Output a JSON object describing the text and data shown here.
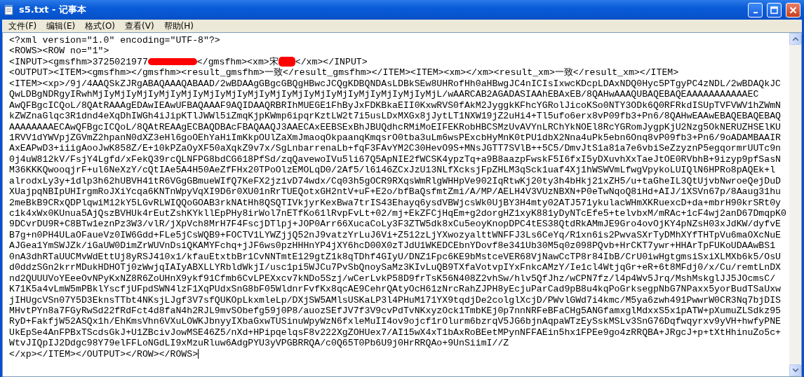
{
  "window": {
    "title": "s5.txt - 记事本"
  },
  "menu": [
    {
      "label": "文件(F)"
    },
    {
      "label": "编辑(E)"
    },
    {
      "label": "格式(O)"
    },
    {
      "label": "查看(V)"
    },
    {
      "label": "帮助(H)"
    }
  ],
  "editor": {
    "lines": [
      {
        "text": "<?xml version=\"1.0\" encoding=\"UTF-8\"?>"
      },
      {
        "text": "<ROWS><ROW no=\"1\">"
      },
      {
        "parts": [
          {
            "kind": "text",
            "text": "<INPUT><gmsfhm>3725021977"
          },
          {
            "kind": "redaction"
          },
          {
            "kind": "text",
            "text": "</gmsfhm><xm>宋"
          },
          {
            "kind": "redaction"
          },
          {
            "kind": "text",
            "text": "</xm></INPUT>"
          }
        ]
      },
      {
        "text": "<OUTPUT><ITEM><gmsfhm></gmsfhm><result_gmsfhm>一致</result_gmsfhm></ITEM><ITEM><xm></xm><result_xm>一致</result_xm></ITEM>"
      },
      {
        "text": "<ITEM><xp>/9j/4AAQSkZJRgABAQAAAQABAAD/2wBDAAgGBgcGBQgHBwcJCQgKDBQNDAsLDBkSEw8UHRofHh0aHBwgJC4nICIsIxwcKDcpLDAxNDQ0Hyc5PTgyPC4zNDL/2wBDAQkJC"
      },
      {
        "text": "QwLDBgNDRgyIRwhMjIyMjIyMjIyMjIyMjIyMjIyMjIyMjIyMjIyMjIyMjIyMjIyMjIyMjIyMjIyMjL/wAARCAB2AGADASIAAhEBAxEB/8QAHwAAAQUBAQEBAQEAAAAAAAAAAAEC"
      },
      {
        "text": "AwQFBgcICQoL/8QAtRAAAgEDAwIEAwUFBAQAAAF9AQIDAAQRBRIhMUEGE1FhByJxFDKBkaEII0KxwRVS0fAkM2JyggkKFhcYGRolJicoKSo0NTY3ODk6Q0RFRkdISUpTVFVWV1hZWmN"
      },
      {
        "text": "kZWZnaGlqc3R1dnd4eXqDhIWGh4iJipKTlJWWl5iZmqKjpKWmp6ipqrKztLW2t7i5usLDxMXGx8jJytLT1NXW19jZ2uHi4+Tl5ufo6erx8vP09fb3+Pn6/8QAHwEAAwEBAQEBAQEBAQ"
      },
      {
        "text": "AAAAAAAAECAwQFBgcICQoL/8QAtREAAgECBAQDBAcFBAQAAQJ3AAECAxEEBSExBhJBUQdhcRMiMoEIFEKRobHBCSMzUvAVYnLRChYkNOEl8RcYGRomJygpKjU2Nzg5OkNERUZHSElKU"
      },
      {
        "text": "1RVV1dYWVpjZGVmZ2hpanN0dXZ3eHl6goOEhYaHiImKkpOUlZaXmJmaoqOkpaanqKmqsrO0tba3uLm6wsPExcbHyMnK0tPU1dbX2Nna4uPk5ebn6Onq8vP09fb3+Pn6/9oADAMBAAIR"
      },
      {
        "text": "AxEAPwD3+iiigAooJwK858Z/E+10kPZaOyXF50aXqkZ9v7x/SgLnbarrenaLb+fqF3FAvYM2C30HevO9S+MNsJGTT7SVlB++5C5/DmvJtS1a81a7e6vbiSeZzyznP5egqormrUUTc9n"
      },
      {
        "text": "0j4uW812kV/FsjY4Lgfd/xFekQ39rcQLNFPG8bdCG618PfSd/zqQavewoIVu5li67Q5ApNIE2fWCSK4ypzTq+a9B8aazpFwskF5I6fxI5yDXuvhXxTaeJtOE0RVbhB+9izyp9pfSasN"
      },
      {
        "text": "M36KKKQwooqjrF+ul6NeXzY/cQtIAe5A4H50AeZfFHx20TPoOlzEMOLqD0/2Af5/l6146ZCxJzU13NLfXcksjFpZHLM3qSck1uaf4Xj1hWSWVmLfwgVpykoLUIQlN6HPRo8pAQEk+l"
      },
      {
        "text": "alrodxLy3y+1dlp3h62hUBVH41tR6VGgGBmueWIfQ7KeFX2jz1vD74wdx/Cq03h5gOCR9RXqsWmRlgWHHpVe902IqRtwKj20ty3h4bHkj21xZH5/u+taGheIL3QtUjvbNwroeQejDuD"
      },
      {
        "text": "XUajpqNBIpUHIrgmRoJXiYcqa6KNTnWpyVqXI9D6r0XU01nRrTUEQotxGH2ntV+uF+E2o/bfBaQsfmtZmi/A/MP/AELH4V3VUzNBXN+P0eTwNqoQ8iHd+AIJ/1XSVn67p/8Aaug31hu"
      },
      {
        "text": "2meBkB9CRxQDPlqwiM12kY5LGvRLWIQQoGOAB3rkNAtHh8QSQTIVkjyrKexBwa7trIS43Ehayq6ysdVBWjcsWk0UjBY3H4mty02ATJ571ykulacWHmXKRuexcD+da+mbrH90krSRt0y"
      },
      {
        "text": "c1k4xWx0KUnua5AjQszBVHUk4rEutZshKYkllEpPHy8irWol7nETfKo61lRvpFvLt+02/mj+EkZFCjHqEm+g2dorgHZ1xyK881yDyNTcEfe5+telvbxM/mRAc+1cF4wj2anD67DmqpK0"
      },
      {
        "text": "9DCvrDU9R+C8BTw1eznPz3W3/vlR/jXpVch8MrH7F4FscjDTlpj+JOP0Arr66XucaCoLy3F3ZTW5dk8xCu5eoyKnopDPC4tES38QtdRkAMmJE9Gro4ovOjKY4pNZsH03xJdKW/dyfvE"
      },
      {
        "text": "B7g+n0PH4ULaOFaueVz0IW6Gdd+FLe5jCsWQB9+FOCTV1LYWZjjQ52nJ9vatzYrLuJ6Vi+Z512zLjYXwozyalttWNFFJ3Ls6CeYq/R1xn6is2PwvaSXrTyDMhXYfTHTpVu6maOXcNuE"
      },
      {
        "text": "AJGea1YmSWJZk/iGaUW0DimZrWUVnDsiQKAMYFchq+jJF6ws0pzHHHnYP4jXY6hcD00X0zTJdU1WKEDCEbnYDovf8e341Ub30M5q0z098PQvb+HrCKT7ywr+HHArTpFUKoUDAAwBS1"
      },
      {
        "text": "0nA3dhRTaUUCMvWdEttUj8yRSJ410x1/kfauEtxtbBr1CvNNTmtE129gtZ1k8qTDhf4GIyU/DNZ1Fpc6KE9bMstceVER68VjNawCcTP8r84IbB/CrU0iwHgtgmsiSxiXLMXb6k5/OsU"
      },
      {
        "text": "d0ddzSGn2krrMDukHDHOTj0zWwjqIAIyABXLLYRbldWkjI/usc1pi5WJCu7PvSbQnoySaMz3KIvLuQB9TXfaVotvpIYxFnkcAMzY/Ie1cl4WtjqGr+eR+6t8MFdj0/x/Cu/remtLnDX"
      },
      {
        "text": "nd2QUUUVoYEeeOvNPyKxNZ8R6ZoUHnX9ykf91Cfmb6CvLPEXxcv7kNDo5Szj/wCerLvkP58D9frTsK56N408Z2vhSw/hlv5QfJhz/wCPN7fz/l4p4Wv5Jrq/MshMskglJJ5JOcmsC/"
      },
      {
        "text": "K71K5a4vLmW5mPBklYscfjUFpdSWN4lzF1XqPUdxSnG8bF05WldnrFvfKx8qcAE9CehrQAtyOcH61zNrcRahZJPH8yEcjuParCad9pB8u4kqPoGrksegpNbG7NPaxx5yorBudTSaUxw"
      },
      {
        "text": "jIHUgcVSn07Y5D3EknsTTbt4NKsjLJgf3V7sfQUKOpLkxmleLp/DXjSW5AMlsUSKaLP3l4PHuM171YX9tqdjDe2colglXcjD/PWvlGWd7i4kmc/M5ya6zwh491PwwrW0CR3Nq7bjDIS"
      },
      {
        "text": "MHvtPYn8a7FGyRwSd22fRdFct4d8faN4h2RJL9mvSObefg59j0P8/auozSEfJV7f3V9cvPdTvNKxyzOck1TmbKEj0p7nnNRFeBFaCHg5ANGfamxglMdxxS5x1pATW+pXumuZLSdkz95"
      },
      {
        "text": "RyD+FakfjW52ASQx1h/EhKmsVhn6VXuLOWKJbnyyIXbaGxwTUSinuWpyWzN6fxleMuII4ov9ojcf1rOlurm6bzrqV5JG6bjnAqpaWTzEySskMSLv3SnG76Dqfwqyrxv9yVH+hwfyPNE"
      },
      {
        "text": "UkEpSe4AnFPBxTScdsGkJ+U1ZBcivJowMSE46Z5/nXd+HPipqelqsF8v222XgZOHUex7/AI15wX4xT1bAxRoBEetMPynNFFAEin5hx1FPEe9go4zRRQBA+JRgcJ+p+tXtHhinuZo5c+"
      },
      {
        "text": "WtvJIQpIJ2Ddgc98Y79elFFLoNGdLI9xMzuRluw6AdgPYU3yVPGBRRQA/c0Q65T0Pb6U9j0HrRRQAo+9UnSiimI//Z"
      },
      {
        "text": "</xp></ITEM></OUTPUT></ROW></ROWS>"
      }
    ]
  }
}
